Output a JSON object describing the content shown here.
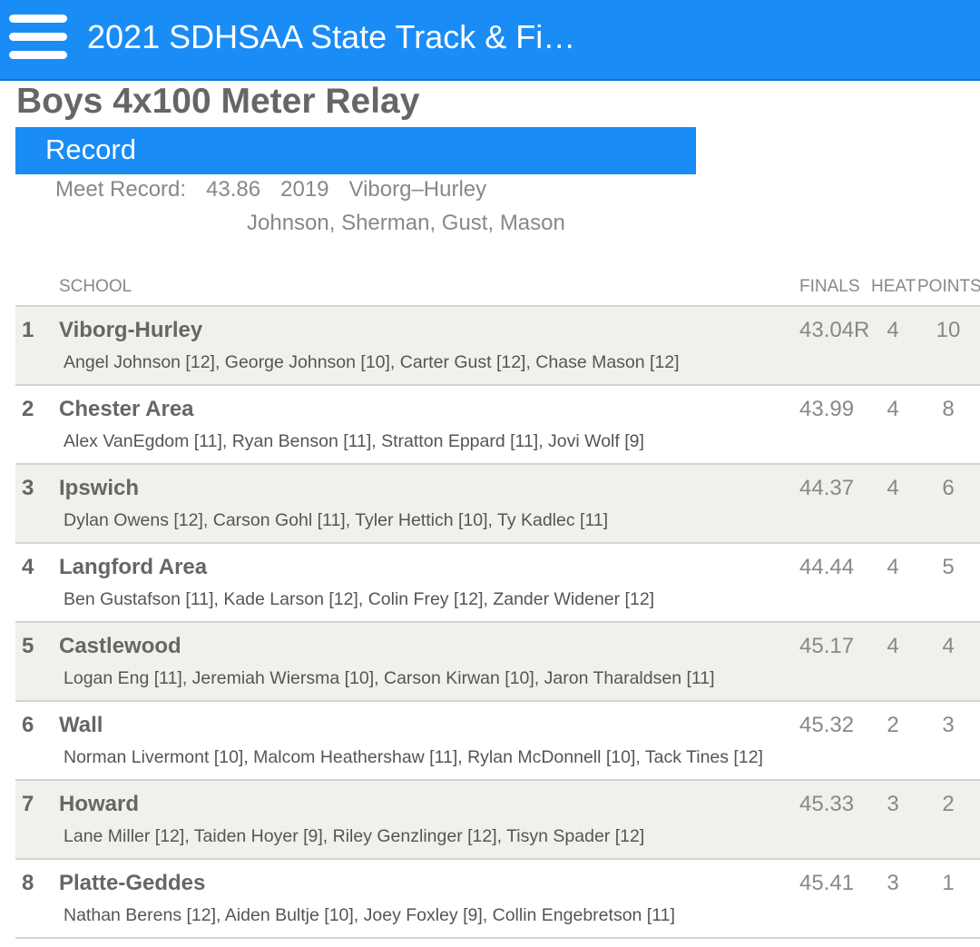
{
  "header": {
    "title": "2021 SDHSAA State Track & Fi…",
    "menu_icon": "hamburger-menu-icon",
    "colors": {
      "bar": "#1a8cf5",
      "text": "#ffffff"
    }
  },
  "event": {
    "title": "Boys 4x100 Meter Relay"
  },
  "record": {
    "section_label": "Record",
    "label": "Meet Record:",
    "mark": "43.86",
    "year": "2019",
    "school": "Viborg–Hurley",
    "athletes": "Johnson, Sherman, Gust, Mason"
  },
  "table": {
    "headers": {
      "school": "SCHOOL",
      "finals": "FINALS",
      "heat": "HEAT",
      "points": "POINTS"
    },
    "rows": [
      {
        "place": "1",
        "school": "Viborg-Hurley",
        "athletes": "Angel Johnson [12], George Johnson [10], Carter Gust [12], Chase Mason [12]",
        "mark": "43.04R",
        "heat": "4",
        "points": "10"
      },
      {
        "place": "2",
        "school": "Chester Area",
        "athletes": "Alex VanEgdom [11], Ryan Benson [11], Stratton Eppard [11], Jovi Wolf [9]",
        "mark": "43.99",
        "heat": "4",
        "points": "8"
      },
      {
        "place": "3",
        "school": "Ipswich",
        "athletes": "Dylan Owens [12], Carson Gohl [11], Tyler Hettich [10], Ty Kadlec [11]",
        "mark": "44.37",
        "heat": "4",
        "points": "6"
      },
      {
        "place": "4",
        "school": "Langford Area",
        "athletes": "Ben Gustafson [11], Kade Larson [12], Colin Frey [12], Zander Widener [12]",
        "mark": "44.44",
        "heat": "4",
        "points": "5"
      },
      {
        "place": "5",
        "school": "Castlewood",
        "athletes": "Logan Eng [11], Jeremiah Wiersma [10], Carson Kirwan [10], Jaron Tharaldsen [11]",
        "mark": "45.17",
        "heat": "4",
        "points": "4"
      },
      {
        "place": "6",
        "school": "Wall",
        "athletes": "Norman Livermont [10], Malcom Heathershaw [11], Rylan McDonnell [10], Tack Tines [12]",
        "mark": "45.32",
        "heat": "2",
        "points": "3"
      },
      {
        "place": "7",
        "school": "Howard",
        "athletes": "Lane Miller [12], Taiden Hoyer [9], Riley Genzlinger [12], Tisyn Spader [12]",
        "mark": "45.33",
        "heat": "3",
        "points": "2"
      },
      {
        "place": "8",
        "school": "Platte-Geddes",
        "athletes": "Nathan Berens [12], Aiden Bultje [10], Joey Foxley [9], Collin Engebretson [11]",
        "mark": "45.41",
        "heat": "3",
        "points": "1"
      }
    ]
  }
}
